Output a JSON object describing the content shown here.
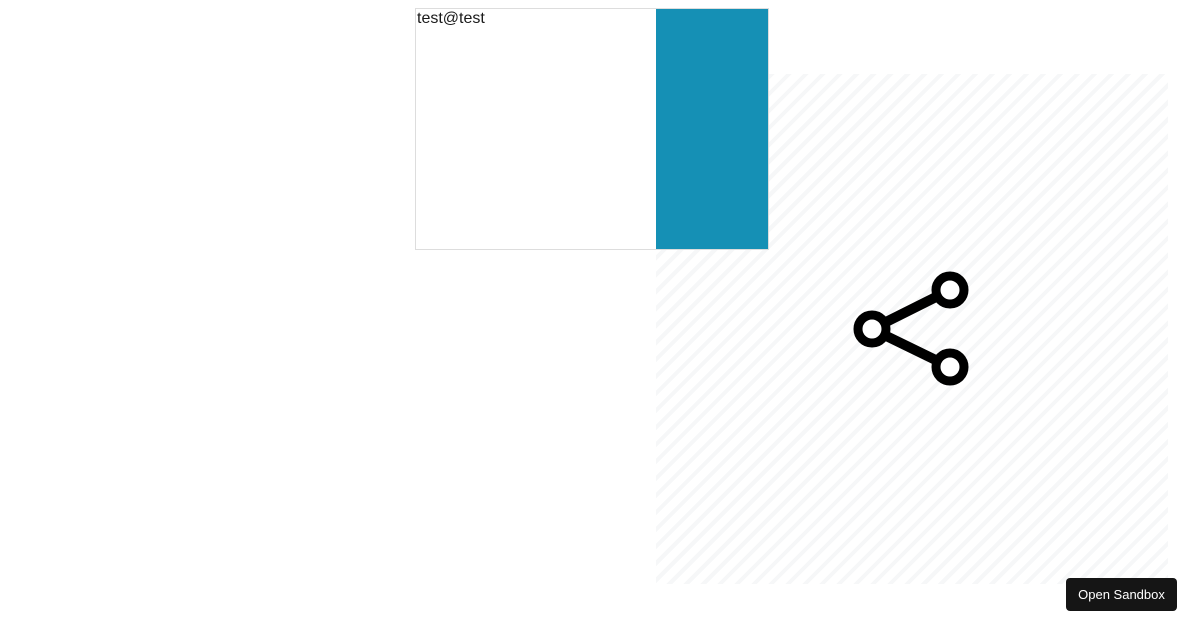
{
  "card": {
    "email": "test@test",
    "accent_color": "#1590b5"
  },
  "icons": {
    "share": "share-icon"
  },
  "sandbox": {
    "open_label": "Open Sandbox"
  }
}
